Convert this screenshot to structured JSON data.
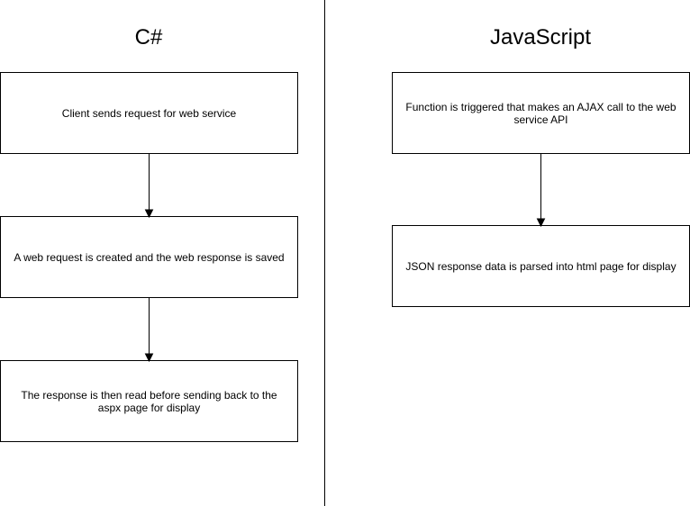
{
  "columns": {
    "csharp": {
      "title": "C#",
      "steps": [
        "Client sends request for web service",
        "A web request is created and the web response is saved",
        "The response is then read before sending back to the aspx page for display"
      ]
    },
    "javascript": {
      "title": "JavaScript",
      "steps": [
        "Function is triggered that makes an AJAX call to the web service API",
        "JSON response data is parsed into html page for display"
      ]
    }
  },
  "colors": {
    "stroke": "#000000",
    "fill": "#ffffff"
  }
}
